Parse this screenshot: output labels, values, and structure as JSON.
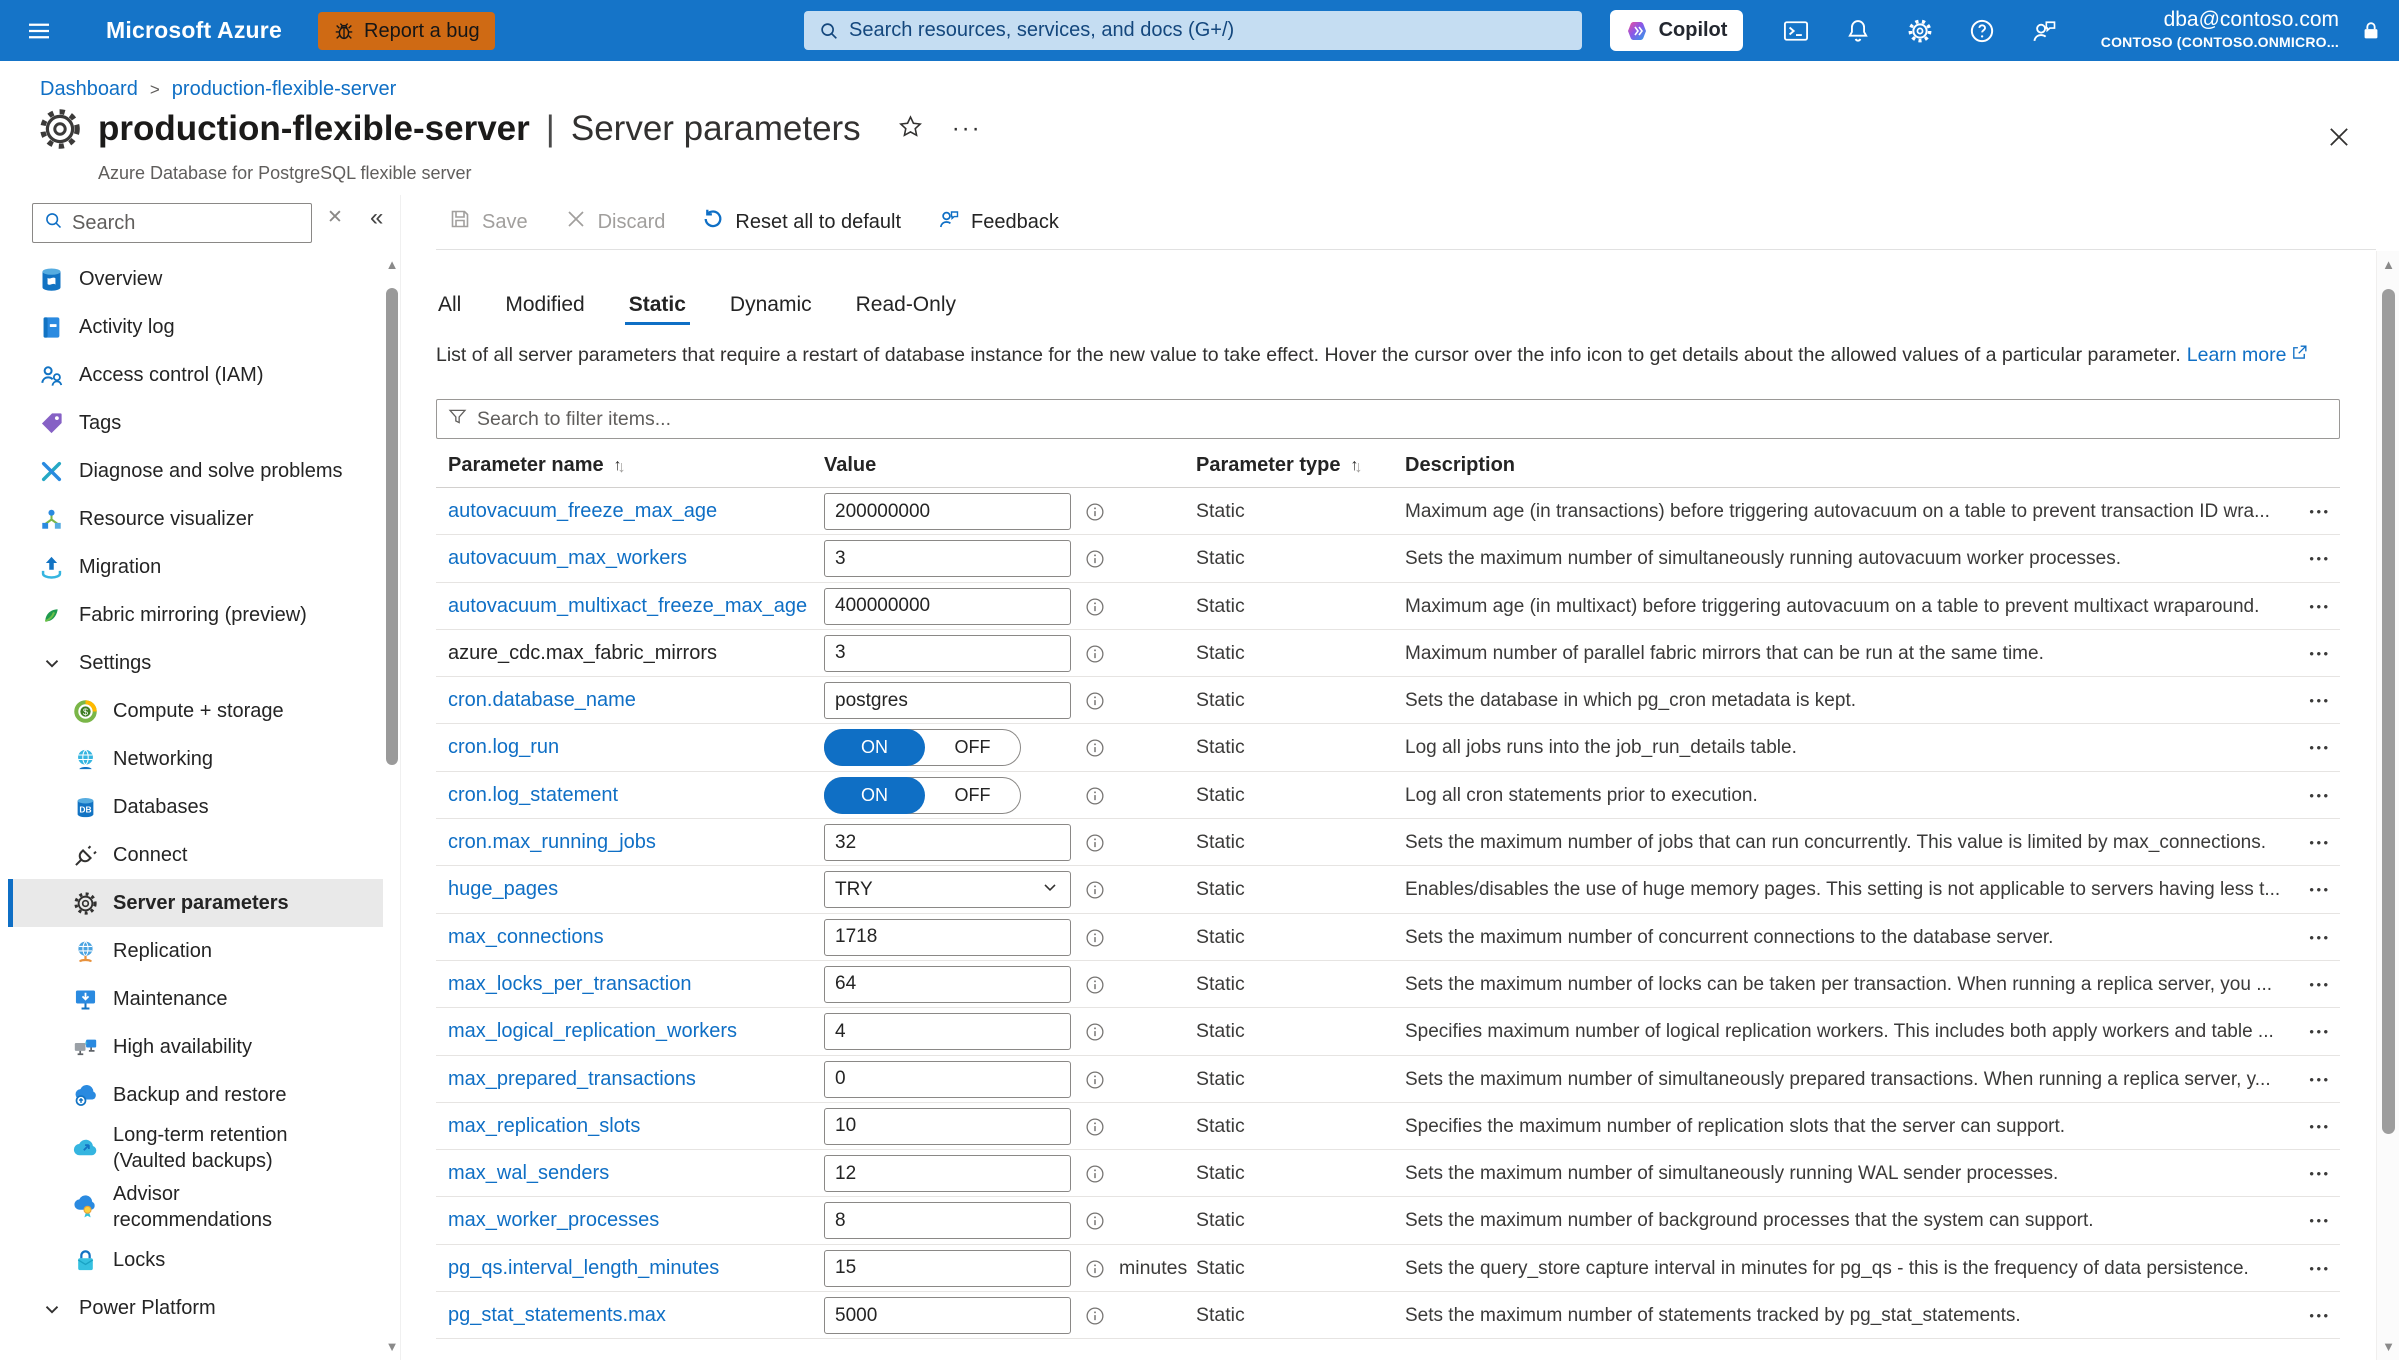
{
  "topbar": {
    "brand": "Microsoft Azure",
    "report_bug_label": "Report a bug",
    "search_placeholder": "Search resources, services, and docs (G+/)",
    "copilot_label": "Copilot",
    "account": {
      "email": "dba@contoso.com",
      "tenant": "CONTOSO (CONTOSO.ONMICRO..."
    },
    "colors": {
      "bar": "#1574c8",
      "bug_button": "#cf6a14",
      "search_bg": "#c5ddf2"
    }
  },
  "breadcrumb": {
    "items": [
      {
        "label": "Dashboard"
      },
      {
        "label": "production-flexible-server"
      }
    ],
    "separator": ">"
  },
  "page": {
    "title_primary": "production-flexible-server",
    "title_separator": "|",
    "title_secondary": "Server parameters",
    "subtitle": "Azure Database for PostgreSQL flexible server",
    "title_menu_dots": "···"
  },
  "sidebar": {
    "search_placeholder": "Search",
    "clear_glyph": "✕",
    "collapse_glyph": "«",
    "items": [
      {
        "label": "Overview",
        "icon": "database-icon",
        "level": 1
      },
      {
        "label": "Activity log",
        "icon": "activity-log-icon",
        "level": 1
      },
      {
        "label": "Access control (IAM)",
        "icon": "access-control-icon",
        "level": 1
      },
      {
        "label": "Tags",
        "icon": "tag-icon",
        "level": 1
      },
      {
        "label": "Diagnose and solve problems",
        "icon": "diagnose-icon",
        "level": 1
      },
      {
        "label": "Resource visualizer",
        "icon": "resource-visualizer-icon",
        "level": 1
      },
      {
        "label": "Migration",
        "icon": "migration-icon",
        "level": 1
      },
      {
        "label": "Fabric mirroring (preview)",
        "icon": "fabric-icon",
        "level": 1
      },
      {
        "label": "Settings",
        "icon": "chevron-down-icon",
        "level": 1,
        "group": true
      },
      {
        "label": "Compute + storage",
        "icon": "compute-storage-icon",
        "level": 2
      },
      {
        "label": "Networking",
        "icon": "networking-icon",
        "level": 2
      },
      {
        "label": "Databases",
        "icon": "databases-icon",
        "level": 2
      },
      {
        "label": "Connect",
        "icon": "connect-icon",
        "level": 2
      },
      {
        "label": "Server parameters",
        "icon": "gear-icon",
        "level": 2,
        "selected": true
      },
      {
        "label": "Replication",
        "icon": "replication-icon",
        "level": 2
      },
      {
        "label": "Maintenance",
        "icon": "maintenance-icon",
        "level": 2
      },
      {
        "label": "High availability",
        "icon": "high-availability-icon",
        "level": 2
      },
      {
        "label": "Backup and restore",
        "icon": "backup-icon",
        "level": 2
      },
      {
        "label": "Long-term retention (Vaulted backups)",
        "icon": "retention-icon",
        "level": 2
      },
      {
        "label": "Advisor recommendations",
        "icon": "advisor-icon",
        "level": 2
      },
      {
        "label": "Locks",
        "icon": "lock-icon",
        "level": 2
      },
      {
        "label": "Power Platform",
        "icon": "chevron-down-icon",
        "level": 1,
        "group": true
      }
    ]
  },
  "toolbar": {
    "save_label": "Save",
    "discard_label": "Discard",
    "reset_label": "Reset all to default",
    "feedback_label": "Feedback"
  },
  "tabs": {
    "items": [
      "All",
      "Modified",
      "Static",
      "Dynamic",
      "Read-Only"
    ],
    "active": "Static"
  },
  "description": {
    "text": "List of all server parameters that require a restart of database instance for the new value to take effect. Hover the cursor over the info icon to get details about the allowed values of a particular parameter.",
    "link_label": "Learn more"
  },
  "filter": {
    "placeholder": "Search to filter items..."
  },
  "table": {
    "headers": {
      "name": "Parameter name",
      "value": "Value",
      "type": "Parameter type",
      "description": "Description"
    },
    "toggle_labels": {
      "on": "ON",
      "off": "OFF"
    },
    "row_menu_glyph": "•••",
    "rows": [
      {
        "name": "autovacuum_freeze_max_age",
        "link": true,
        "control": "input",
        "value": "200000000",
        "type": "Static",
        "description": "Maximum age (in transactions) before triggering autovacuum on a table to prevent transaction ID wra..."
      },
      {
        "name": "autovacuum_max_workers",
        "link": true,
        "control": "input",
        "value": "3",
        "type": "Static",
        "description": "Sets the maximum number of simultaneously running autovacuum worker processes."
      },
      {
        "name": "autovacuum_multixact_freeze_max_age",
        "link": true,
        "control": "input",
        "value": "400000000",
        "type": "Static",
        "description": "Maximum age (in multixact) before triggering autovacuum on a table to prevent multixact wraparound."
      },
      {
        "name": "azure_cdc.max_fabric_mirrors",
        "link": false,
        "control": "input",
        "value": "3",
        "type": "Static",
        "description": "Maximum number of parallel fabric mirrors that can be run at the same time."
      },
      {
        "name": "cron.database_name",
        "link": true,
        "control": "input",
        "value": "postgres",
        "type": "Static",
        "description": "Sets the database in which pg_cron metadata is kept."
      },
      {
        "name": "cron.log_run",
        "link": true,
        "control": "toggle",
        "value": "ON",
        "type": "Static",
        "description": "Log all jobs runs into the job_run_details table."
      },
      {
        "name": "cron.log_statement",
        "link": true,
        "control": "toggle",
        "value": "ON",
        "type": "Static",
        "description": "Log all cron statements prior to execution."
      },
      {
        "name": "cron.max_running_jobs",
        "link": true,
        "control": "input",
        "value": "32",
        "type": "Static",
        "description": "Sets the maximum number of jobs that can run concurrently. This value is limited by max_connections."
      },
      {
        "name": "huge_pages",
        "link": true,
        "control": "select",
        "value": "TRY",
        "type": "Static",
        "description": "Enables/disables the use of huge memory pages. This setting is not applicable to servers having less t..."
      },
      {
        "name": "max_connections",
        "link": true,
        "control": "input",
        "value": "1718",
        "type": "Static",
        "description": "Sets the maximum number of concurrent connections to the database server."
      },
      {
        "name": "max_locks_per_transaction",
        "link": true,
        "control": "input",
        "value": "64",
        "type": "Static",
        "description": "Sets the maximum number of locks can be taken per transaction. When running a replica server, you ..."
      },
      {
        "name": "max_logical_replication_workers",
        "link": true,
        "control": "input",
        "value": "4",
        "type": "Static",
        "description": "Specifies maximum number of logical replication workers. This includes both apply workers and table ..."
      },
      {
        "name": "max_prepared_transactions",
        "link": true,
        "control": "input",
        "value": "0",
        "type": "Static",
        "description": "Sets the maximum number of simultaneously prepared transactions. When running a replica server, y..."
      },
      {
        "name": "max_replication_slots",
        "link": true,
        "control": "input",
        "value": "10",
        "type": "Static",
        "description": "Specifies the maximum number of replication slots that the server can support."
      },
      {
        "name": "max_wal_senders",
        "link": true,
        "control": "input",
        "value": "12",
        "type": "Static",
        "description": "Sets the maximum number of simultaneously running WAL sender processes."
      },
      {
        "name": "max_worker_processes",
        "link": true,
        "control": "input",
        "value": "8",
        "type": "Static",
        "description": "Sets the maximum number of background processes that the system can support."
      },
      {
        "name": "pg_qs.interval_length_minutes",
        "link": true,
        "control": "input",
        "value": "15",
        "unit": "minutes",
        "type": "Static",
        "description": "Sets the query_store capture interval in minutes for pg_qs - this is the frequency of data persistence."
      },
      {
        "name": "pg_stat_statements.max",
        "link": true,
        "control": "input",
        "value": "5000",
        "type": "Static",
        "description": "Sets the maximum number of statements tracked by pg_stat_statements."
      }
    ]
  },
  "colors": {
    "accent": "#0f6fc5",
    "selected_item_bg": "#e9e9e9",
    "toggle_on": "#0f6fc5"
  }
}
